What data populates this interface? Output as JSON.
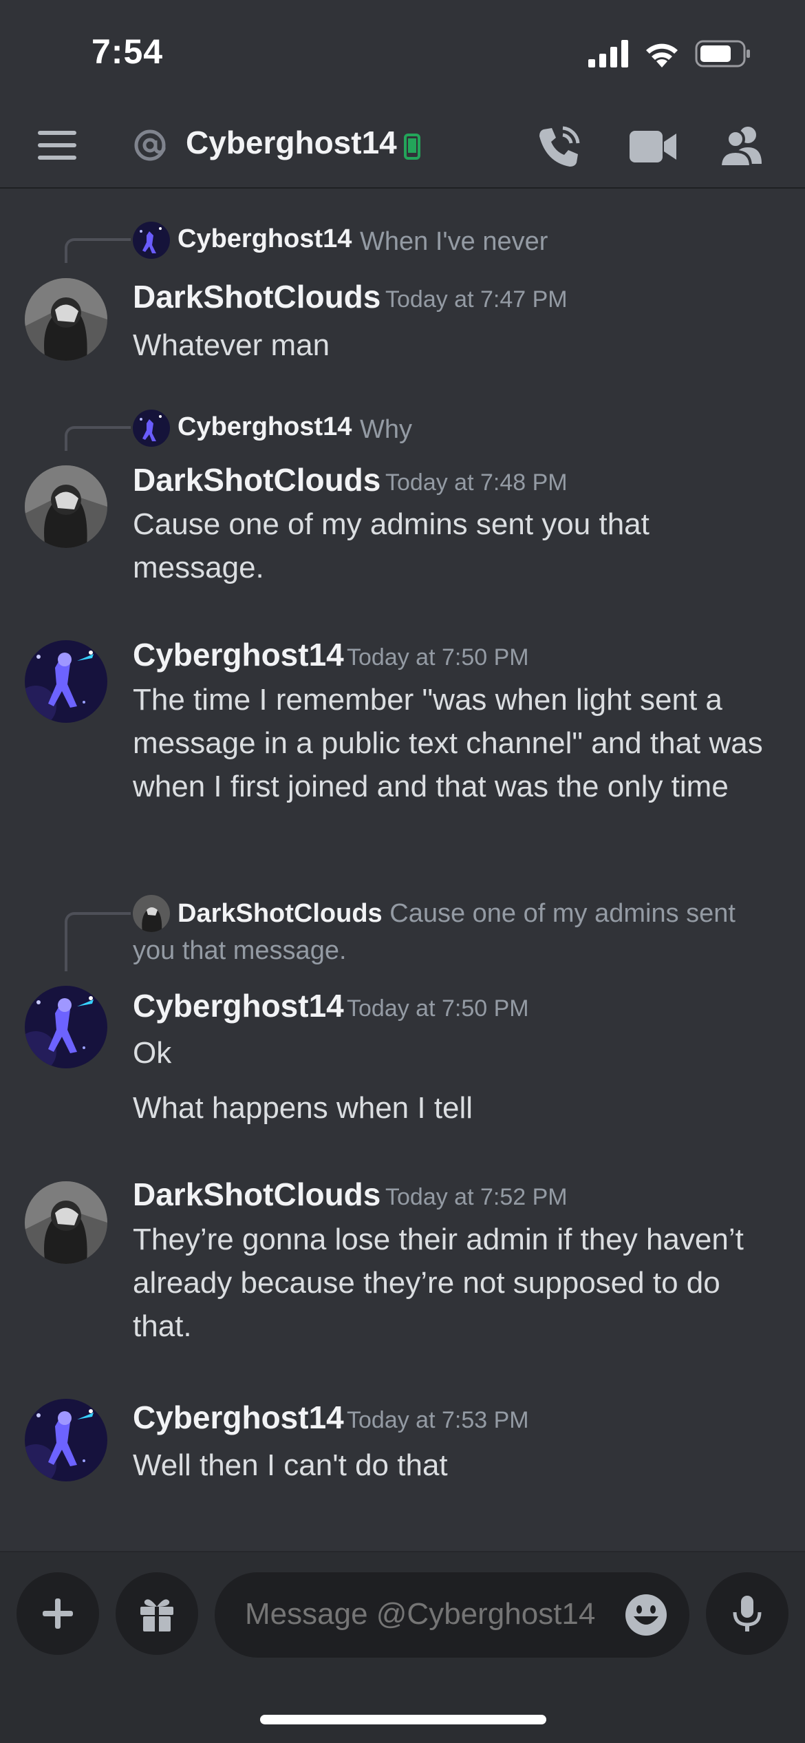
{
  "status_bar": {
    "time": "7:54"
  },
  "header": {
    "at_symbol": "@",
    "channel_name": "Cyberghost14"
  },
  "messages": [
    {
      "reply": {
        "author": "Cyberghost14",
        "text": "When I've never"
      },
      "author": "DarkShotClouds",
      "timestamp": "Today at 7:47 PM",
      "lines": [
        "Whatever man"
      ]
    },
    {
      "reply": {
        "author": "Cyberghost14",
        "text": "Why"
      },
      "author": "DarkShotClouds",
      "timestamp": "Today at 7:48 PM",
      "lines": [
        "Cause one of my admins sent you that message."
      ]
    },
    {
      "author": "Cyberghost14",
      "timestamp": "Today at 7:50 PM",
      "lines": [
        "The time I remember \"was when light sent a message in a public text channel\" and that was when I first joined and that was the only time"
      ]
    },
    {
      "reply": {
        "author": "DarkShotClouds",
        "text": "Cause one of my admins sent you that message."
      },
      "author": "Cyberghost14",
      "timestamp": "Today at 7:50 PM",
      "lines": [
        "Ok",
        "What happens when I tell"
      ]
    },
    {
      "author": "DarkShotClouds",
      "timestamp": "Today at 7:52 PM",
      "lines": [
        "They’re gonna lose their admin if they haven’t already because they’re not supposed to do that."
      ]
    },
    {
      "author": "Cyberghost14",
      "timestamp": "Today at 7:53 PM",
      "lines": [
        "Well then I can't do that"
      ]
    }
  ],
  "composer": {
    "placeholder": "Message @Cyberghost14"
  },
  "icons": {
    "status": [
      "signal-icon",
      "wifi-icon",
      "battery-icon"
    ],
    "header": [
      "menu-icon",
      "at-icon",
      "mobile-status-icon",
      "call-icon",
      "video-icon",
      "members-icon"
    ],
    "composer": [
      "plus-icon",
      "gift-icon",
      "emoji-icon",
      "microphone-icon"
    ]
  },
  "colors": {
    "background": "#313338",
    "composer": "#2b2d31",
    "input": "#1e1f22",
    "online": "#23a55a",
    "muted_text": "#949ba4"
  }
}
